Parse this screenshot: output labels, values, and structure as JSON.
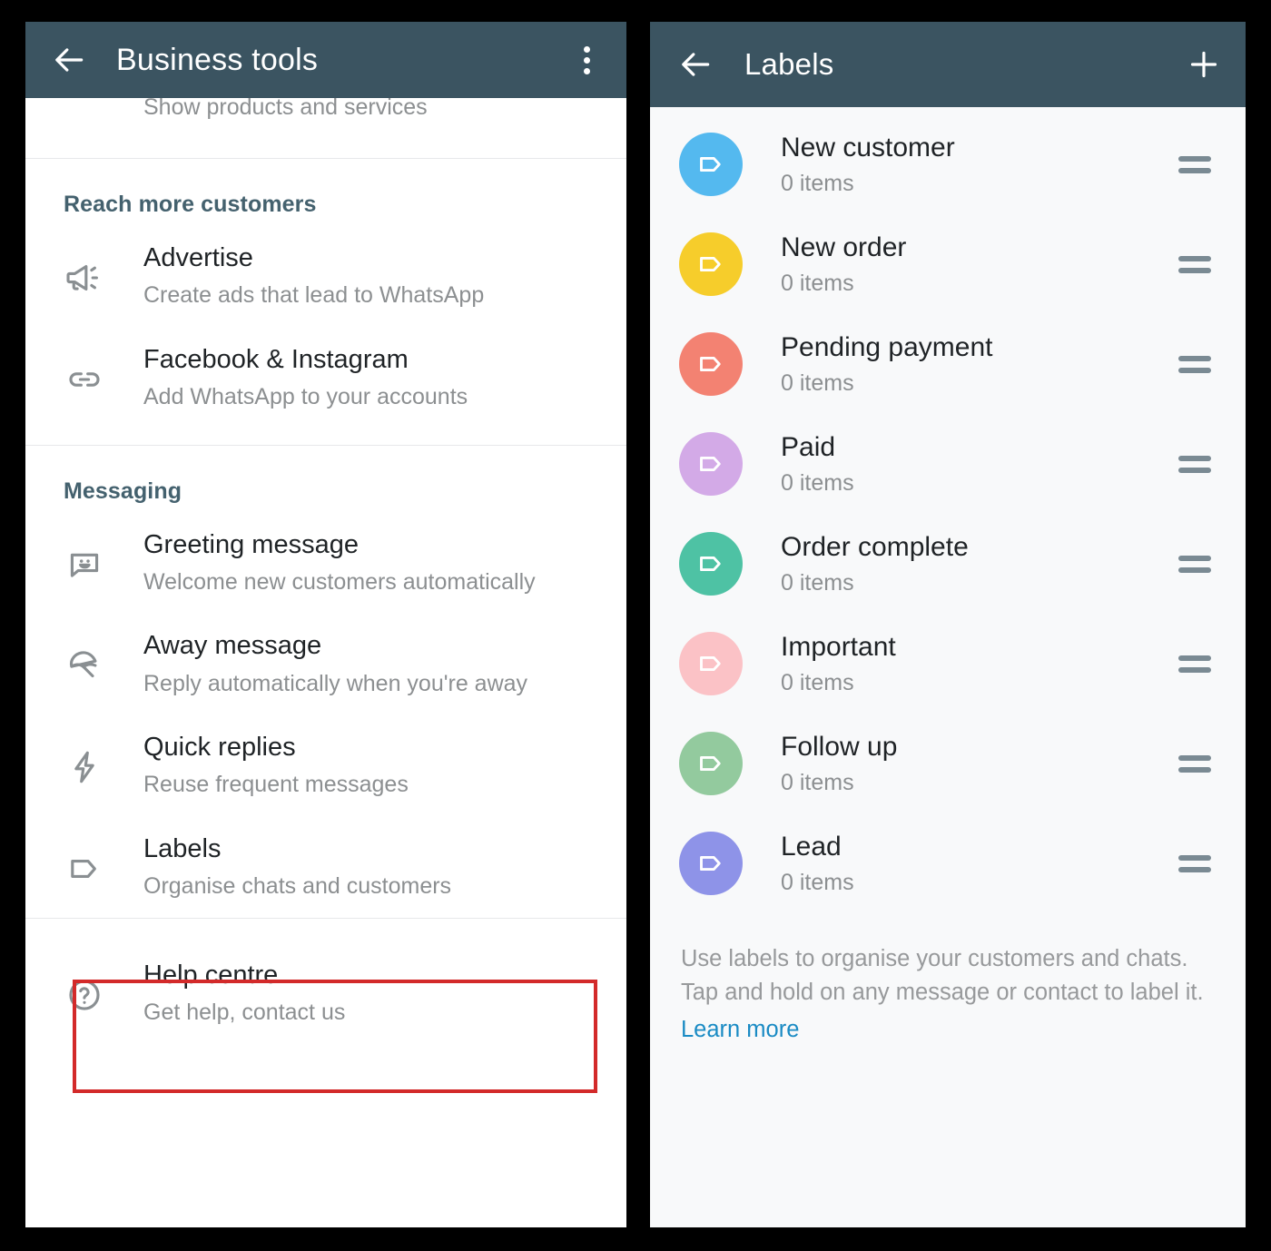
{
  "colors": {
    "appbar": "#3b5461",
    "section_header": "#44616e",
    "highlight_border": "#d32a2a",
    "link": "#1a8bc4",
    "panel_left_bg": "#ffffff",
    "panel_right_bg": "#f8f9fa"
  },
  "business_tools": {
    "appbar": {
      "back_icon": "back-arrow-icon",
      "title": "Business tools",
      "overflow_icon": "kebab-menu-icon"
    },
    "partial_top_row": {
      "subtitle": "Show products and services"
    },
    "sections": [
      {
        "title": "Reach more customers",
        "items": [
          {
            "icon": "megaphone-icon",
            "title": "Advertise",
            "subtitle": "Create ads that lead to WhatsApp",
            "highlighted": false
          },
          {
            "icon": "link-icon",
            "title": "Facebook & Instagram",
            "subtitle": "Add WhatsApp to your accounts",
            "highlighted": false
          }
        ]
      },
      {
        "title": "Messaging",
        "items": [
          {
            "icon": "greeting-message-icon",
            "title": "Greeting message",
            "subtitle": "Welcome new customers automatically",
            "highlighted": false
          },
          {
            "icon": "away-message-icon",
            "title": "Away message",
            "subtitle": "Reply automatically when you're away",
            "highlighted": false
          },
          {
            "icon": "quick-replies-icon",
            "title": "Quick replies",
            "subtitle": "Reuse frequent messages",
            "highlighted": false
          },
          {
            "icon": "label-tag-icon",
            "title": "Labels",
            "subtitle": "Organise chats and customers",
            "highlighted": true
          }
        ]
      },
      {
        "title": "",
        "items": [
          {
            "icon": "help-centre-icon",
            "title": "Help centre",
            "subtitle": "Get help, contact us",
            "highlighted": false
          }
        ]
      }
    ]
  },
  "labels_screen": {
    "appbar": {
      "back_icon": "back-arrow-icon",
      "title": "Labels",
      "add_icon": "plus-icon"
    },
    "labels": [
      {
        "name": "New customer",
        "count": "0 items",
        "color": "#54b9ef"
      },
      {
        "name": "New order",
        "count": "0 items",
        "color": "#f6cd2b"
      },
      {
        "name": "Pending payment",
        "count": "0 items",
        "color": "#f38272"
      },
      {
        "name": "Paid",
        "count": "0 items",
        "color": "#d3aae7"
      },
      {
        "name": "Order complete",
        "count": "0 items",
        "color": "#4ec2a4"
      },
      {
        "name": "Important",
        "count": "0 items",
        "color": "#fbc2c6"
      },
      {
        "name": "Follow up",
        "count": "0 items",
        "color": "#93ca9e"
      },
      {
        "name": "Lead",
        "count": "0 items",
        "color": "#8e93e8"
      }
    ],
    "footer": {
      "line1": "Use labels to organise your customers and chats.",
      "line2": "Tap and hold on any message or contact to label it.",
      "learn_more": "Learn more"
    }
  }
}
